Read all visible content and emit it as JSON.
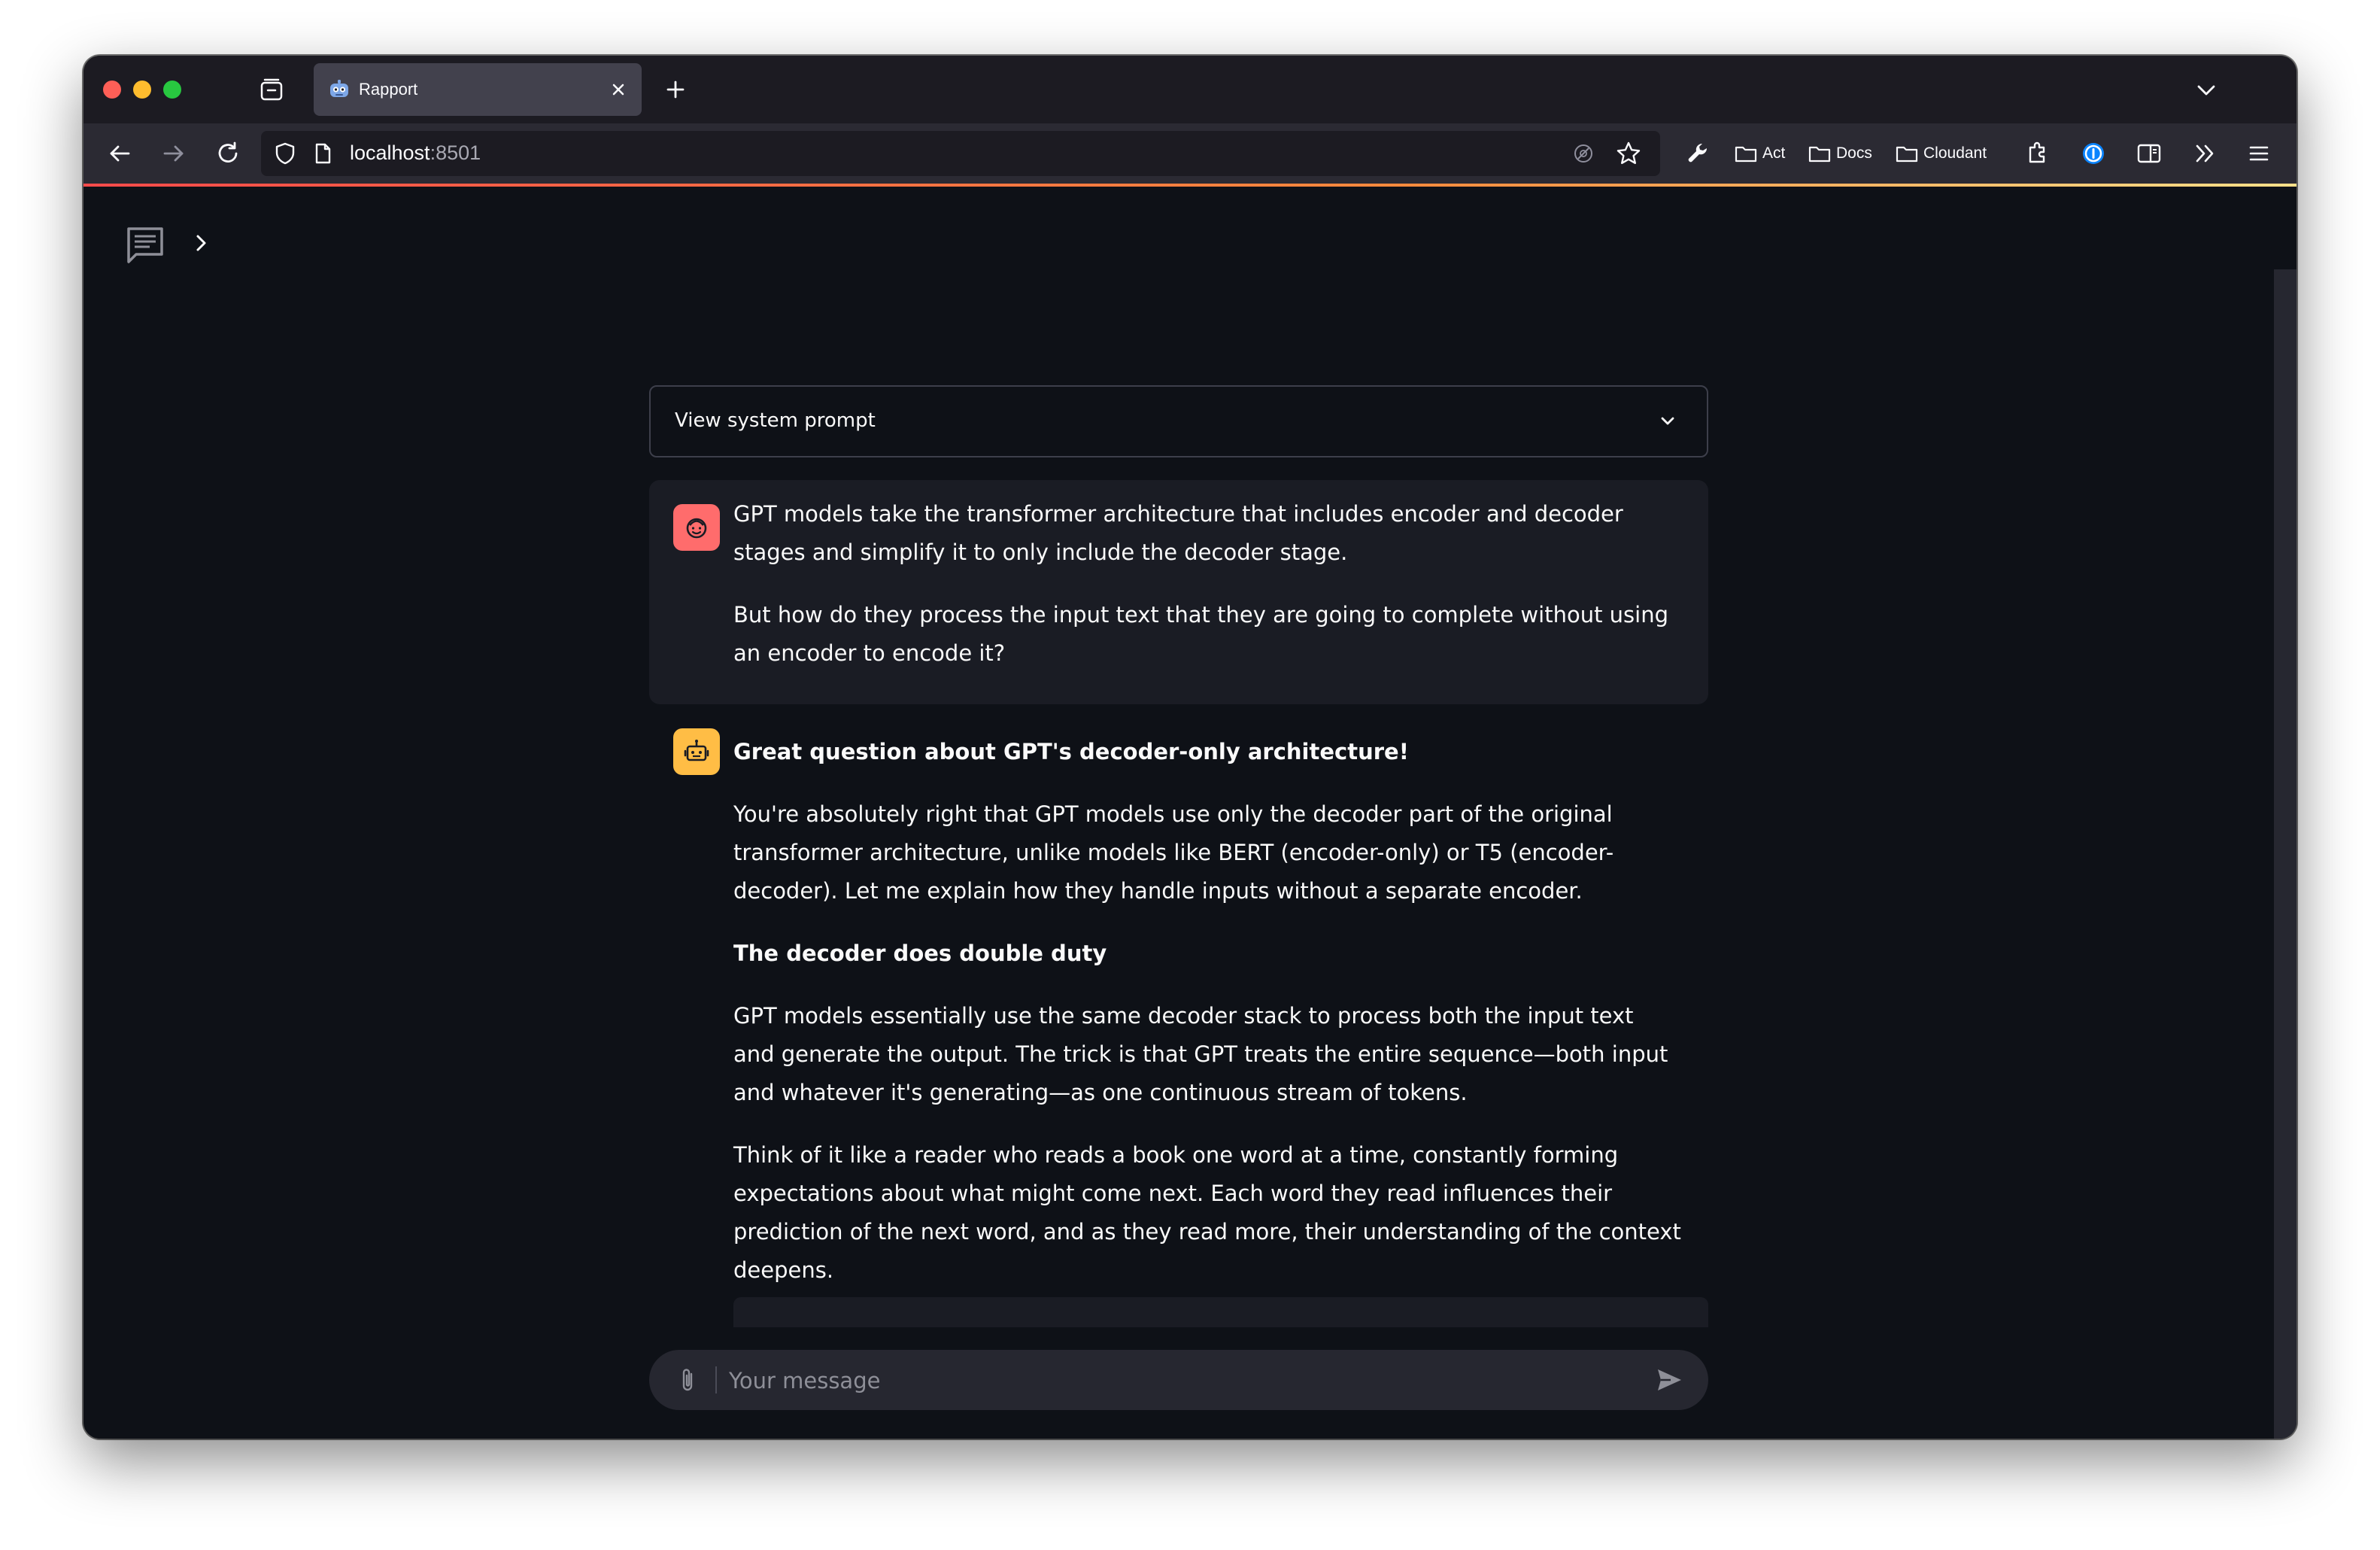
{
  "browser": {
    "tab": {
      "title": "Rapport"
    },
    "url": {
      "host": "localhost",
      "port": ":8501"
    },
    "bookmarks": [
      {
        "label": "Act"
      },
      {
        "label": "Docs"
      },
      {
        "label": "Cloudant"
      }
    ]
  },
  "app": {
    "expander": {
      "label": "View system prompt"
    },
    "messages": {
      "user": {
        "p1": "GPT models take the transformer architecture that includes encoder and decoder stages and simplify it to only include the decoder stage.",
        "p2": "But how do they process the input text that they are going to complete without using an encoder to encode it?"
      },
      "assistant": {
        "heading": "Great question about GPT's decoder-only architecture!",
        "p1": "You're absolutely right that GPT models use only the decoder part of the original transformer architecture, unlike models like BERT (encoder-only) or T5 (encoder-decoder). Let me explain how they handle inputs without a separate encoder.",
        "subheading": "The decoder does double duty",
        "p2": "GPT models essentially use the same decoder stack to process both the input text and generate the output. The trick is that GPT treats the entire sequence—both input and whatever it's generating—as one continuous stream of tokens.",
        "p3": "Think of it like a reader who reads a book one word at a time, constantly forming expectations about what might come next. Each word they read influences their prediction of the next word, and as they read more, their understanding of the context deepens."
      }
    },
    "chat_input": {
      "placeholder": "Your message"
    }
  }
}
